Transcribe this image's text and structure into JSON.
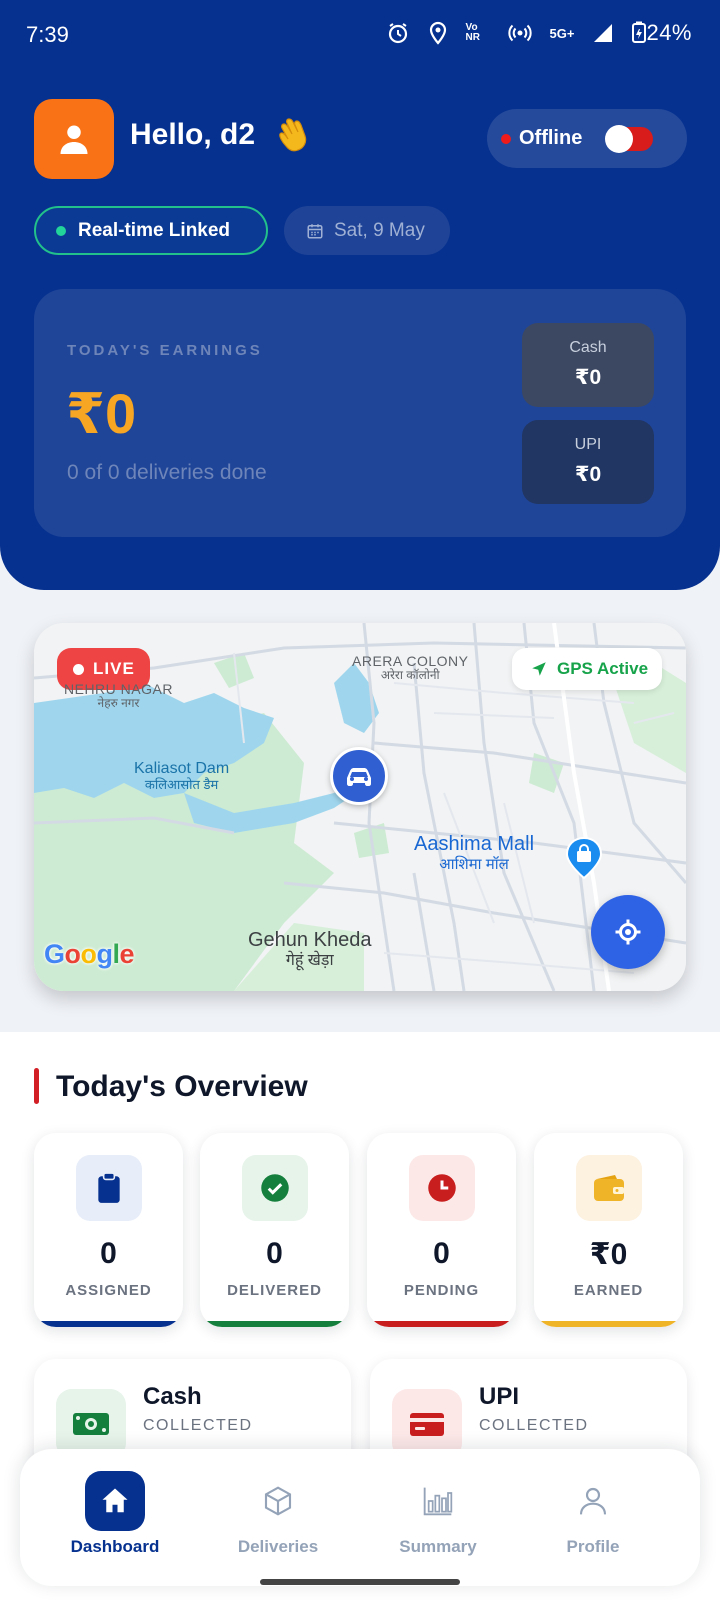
{
  "status_bar": {
    "time": "7:39",
    "network": "5G+",
    "volte": "Vo NR",
    "battery": "24%"
  },
  "header": {
    "greeting": "Hello, d2",
    "status_label": "Offline",
    "linked_label": "Real-time Linked",
    "date": "Sat, 9 May"
  },
  "earnings": {
    "title": "TODAY'S EARNINGS",
    "amount": "₹0",
    "subtitle": "0 of 0 deliveries done",
    "cash_label": "Cash",
    "cash_value": "₹0",
    "upi_label": "UPI",
    "upi_value": "₹0"
  },
  "map": {
    "live_label": "LIVE",
    "gps_label": "GPS Active",
    "labels": {
      "nehru_en": "NEHRU NAGAR",
      "nehru_hi": "नेहरु नगर",
      "arera_en": "ARERA COLONY",
      "arera_hi": "अरेरा कॉलोनी",
      "dam_en": "Kaliasot Dam",
      "dam_hi": "कलिआसोत डैम",
      "mall_en": "Aashima Mall",
      "mall_hi": "आशिमा मॉल",
      "kheda_en": "Gehun Kheda",
      "kheda_hi": "गेहूं खेड़ा"
    },
    "google": "Google"
  },
  "overview": {
    "title": "Today's Overview",
    "stats": [
      {
        "value": "0",
        "label": "ASSIGNED"
      },
      {
        "value": "0",
        "label": "DELIVERED"
      },
      {
        "value": "0",
        "label": "PENDING"
      },
      {
        "value": "₹0",
        "label": "EARNED"
      }
    ],
    "collections": [
      {
        "title": "Cash",
        "subtitle": "COLLECTED"
      },
      {
        "title": "UPI",
        "subtitle": "COLLECTED"
      }
    ]
  },
  "nav": [
    {
      "label": "Dashboard"
    },
    {
      "label": "Deliveries"
    },
    {
      "label": "Summary"
    },
    {
      "label": "Profile"
    }
  ],
  "colors": {
    "primary": "#06318f",
    "accent_orange": "#f97316",
    "earning_gold": "#f6a623",
    "live_red": "#ef4444",
    "gps_green": "#16a34a",
    "assigned": "#06318f",
    "delivered": "#15803d",
    "pending": "#c81e1e",
    "earned": "#f0b429"
  }
}
